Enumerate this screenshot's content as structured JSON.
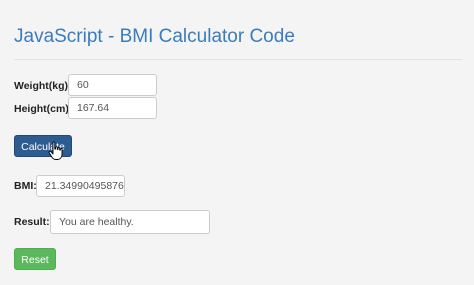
{
  "title": "JavaScript - BMI Calculator Code",
  "form": {
    "weight": {
      "label": "Weight(kg):",
      "value": "60"
    },
    "height": {
      "label": "Height(cm):",
      "value": "167.64"
    },
    "calculate_label": "Calculate",
    "bmi": {
      "label": "BMI:",
      "value": "21.34990495876"
    },
    "result": {
      "label": "Result:",
      "value": "You are healthy."
    },
    "reset_label": "Reset"
  },
  "colors": {
    "title": "#3b7bbf",
    "calculate_button": "#2c5c90",
    "reset_button": "#5cb85c"
  },
  "icons": {
    "cursor": "hand-pointer-icon"
  }
}
